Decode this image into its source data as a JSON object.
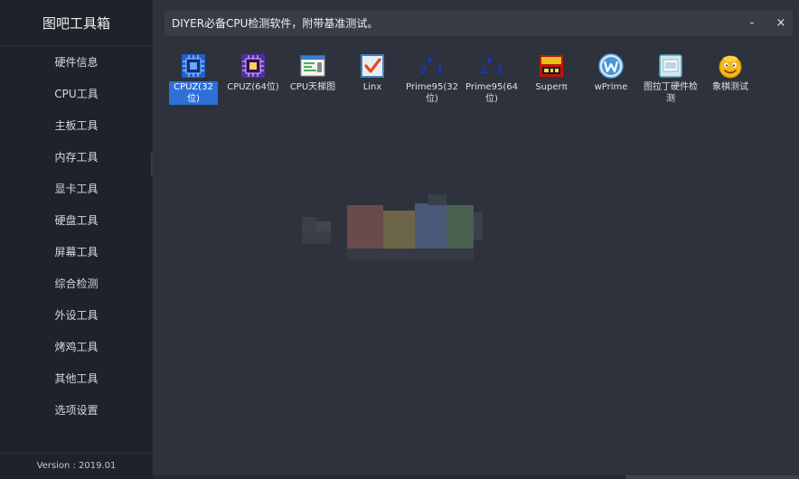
{
  "sidebar": {
    "title": "图吧工具箱",
    "items": [
      {
        "label": "硬件信息"
      },
      {
        "label": "CPU工具"
      },
      {
        "label": "主板工具"
      },
      {
        "label": "内存工具"
      },
      {
        "label": "显卡工具"
      },
      {
        "label": "硬盘工具"
      },
      {
        "label": "屏幕工具"
      },
      {
        "label": "综合检测"
      },
      {
        "label": "外设工具"
      },
      {
        "label": "烤鸡工具"
      },
      {
        "label": "其他工具"
      },
      {
        "label": "选项设置"
      }
    ],
    "version": "Version : 2019.01"
  },
  "header": {
    "text": "DIYER必备CPU检测软件，附带基准测试。",
    "minimize_label": "-",
    "close_label": "×"
  },
  "tools": [
    {
      "label": "CPUZ(32位)",
      "icon": "cpuz-chip-icon",
      "selected": true
    },
    {
      "label": "CPUZ(64位)",
      "icon": "cpuz64-chip-icon",
      "selected": false
    },
    {
      "label": "CPU天梯图",
      "icon": "cpu-ladder-chart-icon",
      "selected": false
    },
    {
      "label": "Linx",
      "icon": "linx-checkmark-icon",
      "selected": false
    },
    {
      "label": "Prime95(32位)",
      "icon": "prime95-formula-icon",
      "selected": false
    },
    {
      "label": "Prime95(64位)",
      "icon": "prime95-64-formula-icon",
      "selected": false
    },
    {
      "label": "Superπ",
      "icon": "superpi-icon",
      "selected": false
    },
    {
      "label": "wPrime",
      "icon": "wprime-icon",
      "selected": false
    },
    {
      "label": "图拉丁硬件检测",
      "icon": "tulading-monitor-icon",
      "selected": false
    },
    {
      "label": "象棋测试",
      "icon": "chess-smiley-icon",
      "selected": false
    }
  ],
  "colors": {
    "sidebar_bg": "#1f2329",
    "main_bg": "#2d323c",
    "header_bg": "#373c47",
    "selection": "#2f6fd6"
  }
}
